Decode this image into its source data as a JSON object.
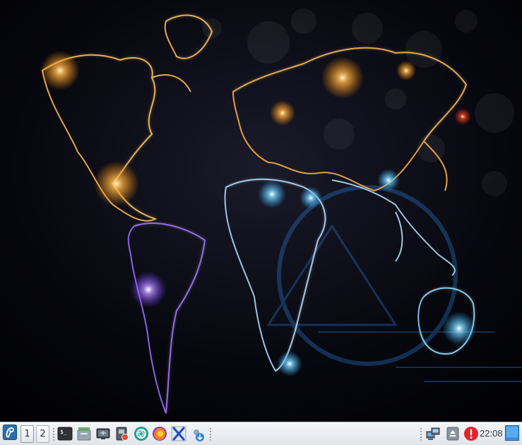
{
  "desktop": {
    "wallpaper": "neon-world-map-icon",
    "colors": {
      "background": "#05060b",
      "warm_glow": "#ffb347",
      "cool_glow": "#7fd8ff",
      "violet_glow": "#9a6cff"
    }
  },
  "panel": {
    "menu_icon": "distro-logo-icon",
    "workspaces": [
      {
        "label": "1",
        "active": true
      },
      {
        "label": "2",
        "active": false
      }
    ],
    "launchers": [
      {
        "name": "terminal-icon"
      },
      {
        "name": "file-manager-icon"
      },
      {
        "name": "network-monitor-icon"
      },
      {
        "name": "screenshot-tool-icon"
      },
      {
        "name": "aperture-app-icon"
      },
      {
        "name": "firefox-icon"
      },
      {
        "name": "xfig-app-icon"
      },
      {
        "name": "update-tool-icon"
      }
    ],
    "tray": {
      "network": "network-computers-icon",
      "eject": "eject-icon",
      "alert": "alert-icon",
      "clock": "22:08",
      "show_desktop": "show-desktop-icon"
    }
  }
}
